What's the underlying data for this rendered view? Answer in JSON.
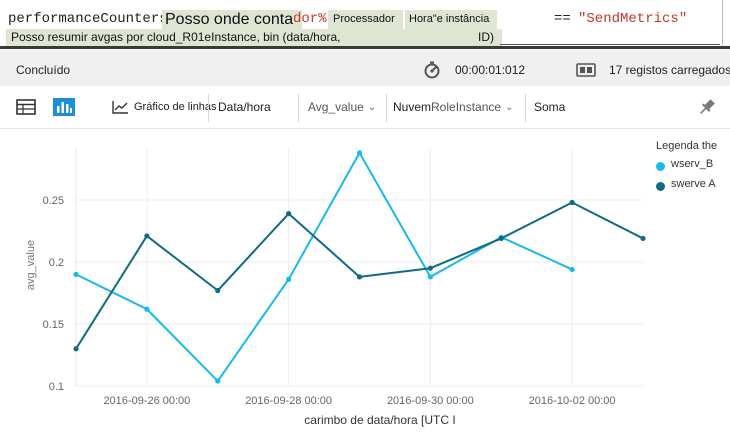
{
  "query": {
    "line1": {
      "table": "performanceCounters",
      "overlay_text": "Posso onde conta",
      "operator": "dor%",
      "processor": "Processador",
      "hour_instance": "Hora\"e instância",
      "equals": "==",
      "send_metrics": "\"SendMetrics\""
    },
    "line2": {
      "summary": "Posso resumir avgas por cloud_R01eInstance, bin (data/hora,",
      "suffix": "ID)"
    }
  },
  "status": {
    "state": "Concluído",
    "elapsed": "00:00:01:012",
    "records": "17  registos carregados"
  },
  "toolbar": {
    "chart_type": "Gráfico de linhas",
    "x_field": "Data/hora",
    "y_field": "Avg_value",
    "split_prefix": "Nuvem",
    "split_field": "RoleInstance",
    "aggregation": "Soma"
  },
  "colors": {
    "series_b": "#19b9e8",
    "series_a": "#0f6b80",
    "axis_text": "#666666",
    "editor_highlight": "#dfe5d3",
    "string_literal": "#c0392b"
  },
  "legend": {
    "title": "Legenda the",
    "items": [
      "wserv_B",
      "swerve A"
    ]
  },
  "chart_data": {
    "type": "line",
    "x": [
      "2016-09-25 00:00",
      "2016-09-26 00:00",
      "2016-09-27 00:00",
      "2016-09-28 00:00",
      "2016-09-29 00:00",
      "2016-09-30 00:00",
      "2016-10-01 00:00",
      "2016-10-02 00:00",
      "2016-10-03 00:00"
    ],
    "x_tick_labels": [
      "2016-09-26 00:00",
      "2016-09-28 00:00",
      "2016-09-30 00:00",
      "2016-10-02 00:00"
    ],
    "series": [
      {
        "name": "wserv_B",
        "values": [
          0.19,
          0.162,
          0.104,
          0.186,
          0.288,
          0.188,
          0.22,
          0.194,
          null
        ]
      },
      {
        "name": "swerve A",
        "values": [
          0.13,
          0.221,
          0.177,
          0.239,
          0.188,
          0.195,
          0.219,
          0.248,
          0.219
        ]
      }
    ],
    "xlabel": "carimbo de data/hora [UTC I",
    "ylabel": "avg_value",
    "y_ticks": [
      0.1,
      0.15,
      0.2,
      0.25
    ],
    "y_tick_labels": [
      "0.1",
      "0.15",
      "0.2",
      "0.25"
    ],
    "ylim": [
      0.1,
      0.3
    ],
    "grid": true,
    "legend_position": "top-right"
  }
}
